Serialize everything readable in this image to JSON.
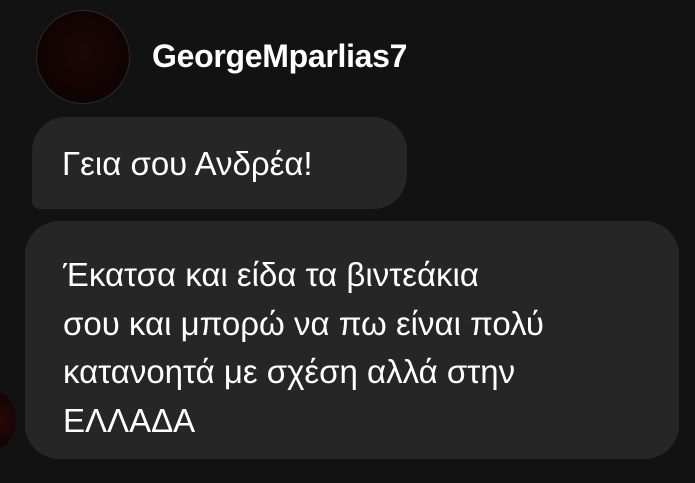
{
  "header": {
    "username": "GeorgeMparlias7"
  },
  "messages": [
    {
      "lines": [
        "Γεια σου Ανδρέα!"
      ]
    },
    {
      "lines": [
        "Έκατσα και είδα τα βιντεάκια",
        "σου και μπορώ να πω είναι πολύ",
        "κατανοητά με σχέση αλλά στην",
        "ΕΛΛΑΔΑ"
      ]
    }
  ],
  "colors": {
    "background": "#121212",
    "bubble": "#262626",
    "text": "#ffffff"
  }
}
